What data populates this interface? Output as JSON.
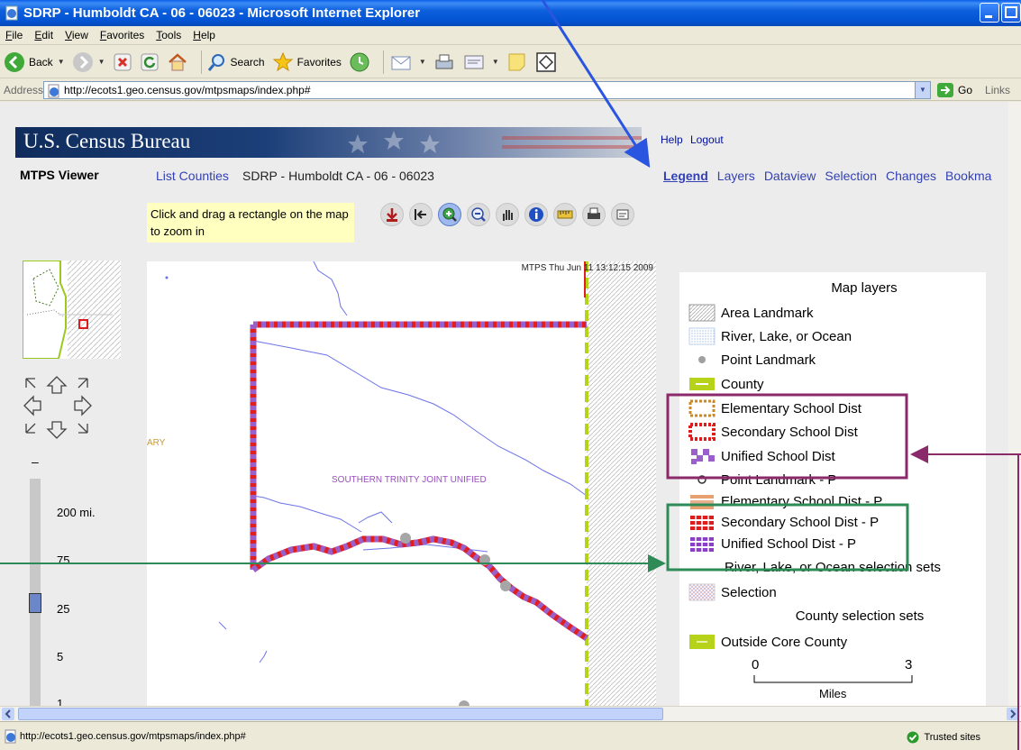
{
  "window": {
    "title": "SDRP - Humboldt CA - 06 - 06023 - Microsoft Internet Explorer"
  },
  "menu": [
    "File",
    "Edit",
    "View",
    "Favorites",
    "Tools",
    "Help"
  ],
  "toolbar": {
    "back": "Back",
    "search": "Search",
    "favorites": "Favorites"
  },
  "address": {
    "label": "Address",
    "url": "http://ecots1.geo.census.gov/mtpsmaps/index.php#",
    "go": "Go",
    "links": "Links"
  },
  "page": {
    "banner_title": "U.S. Census Bureau",
    "help": "Help",
    "logout": "Logout",
    "viewer_label": "MTPS Viewer",
    "list_counties": "List Counties",
    "county_title": "SDRP - Humboldt CA - 06 - 06023",
    "tabs": [
      "Legend",
      "Layers",
      "Dataview",
      "Selection",
      "Changes",
      "Bookma"
    ],
    "hint": "Click and drag a rectangle on the map to zoom in"
  },
  "scale": {
    "minus": "–",
    "labels": [
      "200 mi.",
      "75",
      "25",
      "5",
      "1"
    ]
  },
  "map": {
    "timestamp": "MTPS Thu Jun 11 13:12:15 2009",
    "district_label": "SOUTHERN TRINITY JOINT UNIFIED",
    "edge_label": "ARY"
  },
  "legend": {
    "heading_map_layers": "Map layers",
    "items": [
      "Area Landmark",
      "River, Lake, or Ocean",
      "Point Landmark",
      "County",
      "Elementary School Dist",
      "Secondary School Dist",
      "Unified School Dist",
      "Point Landmark - P",
      "Elementary School Dist - P",
      "Secondary School Dist - P",
      "Unified School Dist - P"
    ],
    "heading_river_sets": "River, Lake, or Ocean selection sets",
    "selection": "Selection",
    "heading_county_sets": "County selection sets",
    "outside_core": "Outside Core County",
    "scale_min": "0",
    "scale_max": "3",
    "scale_units": "Miles"
  },
  "status": {
    "url": "http://ecots1.geo.census.gov/mtpsmaps/index.php#",
    "zone": "Trusted sites"
  },
  "colors": {
    "titlebar": "#0a5ee8",
    "link": "#3341b4",
    "annotation_purple": "#8b2a6b",
    "annotation_green": "#2e8b57",
    "annotation_blue": "#2a55e0",
    "county_green": "#b6d31a",
    "unified_purple": "#9a5fc8"
  }
}
